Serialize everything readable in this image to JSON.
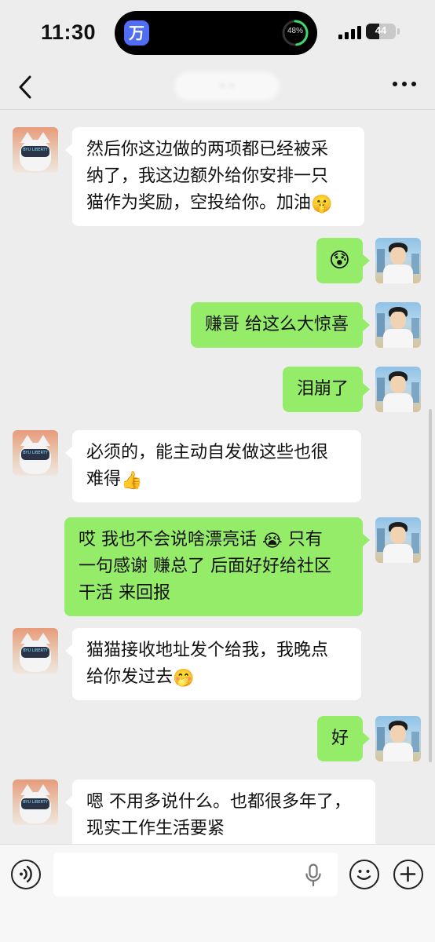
{
  "status_bar": {
    "time": "11:30",
    "island_app_glyph": "万",
    "island_percent": "48%",
    "island_progress": 0.48,
    "battery_level": "44",
    "battery_fraction": 0.44
  },
  "nav": {
    "title": "· ·",
    "back_icon": "chevron-left-icon",
    "more_icon": "more-dots-icon"
  },
  "messages": [
    {
      "side": "left",
      "avatar": "cat",
      "avatar_text": "BYU LIBERTY",
      "parts": [
        "然后你这边做的两项都已经被采",
        "纳了，我这边额外给你安排一只",
        "猫作为奖励，空投给你。加油"
      ],
      "emoji": "🤫"
    },
    {
      "side": "right",
      "avatar": "boy",
      "parts": [],
      "emoji": "😰"
    },
    {
      "side": "right",
      "avatar": "boy",
      "parts": [
        "赚哥 给这么大惊喜"
      ],
      "emoji": ""
    },
    {
      "side": "right",
      "avatar": "boy",
      "parts": [
        "泪崩了"
      ],
      "emoji": ""
    },
    {
      "side": "left",
      "avatar": "cat",
      "avatar_text": "BYU LIBERTY",
      "parts": [
        "必须的，能主动自发做这些也很",
        "难得"
      ],
      "emoji": "👍"
    },
    {
      "side": "right",
      "avatar": "boy",
      "parts": [
        "哎 我也不会说啥漂亮话",
        "一句感谢 赚总了 后面好好给社区",
        "干活 来回报"
      ],
      "emoji": "😭",
      "emoji_after_part0": "只有"
    },
    {
      "side": "left",
      "avatar": "cat",
      "avatar_text": "BYU LIBERTY",
      "parts": [
        "猫猫接收地址发个给我，我晚点",
        "给你发过去"
      ],
      "emoji": "🤭"
    },
    {
      "side": "right",
      "avatar": "boy",
      "parts": [
        "好"
      ],
      "emoji": ""
    },
    {
      "side": "left",
      "avatar": "cat",
      "avatar_text": "BYU LIBERTY",
      "parts": [
        "嗯 不用多说什么。也都很多年了，",
        "现实工作生活要紧"
      ],
      "emoji": ""
    }
  ],
  "input_bar": {
    "voice_icon": "voice-icon",
    "mic_icon": "mic-icon",
    "emoji_icon": "emoji-icon",
    "add_icon": "add-icon",
    "placeholder": ""
  },
  "colors": {
    "background": "#ededed",
    "bubble_self": "#95ec69",
    "bubble_other": "#ffffff"
  }
}
